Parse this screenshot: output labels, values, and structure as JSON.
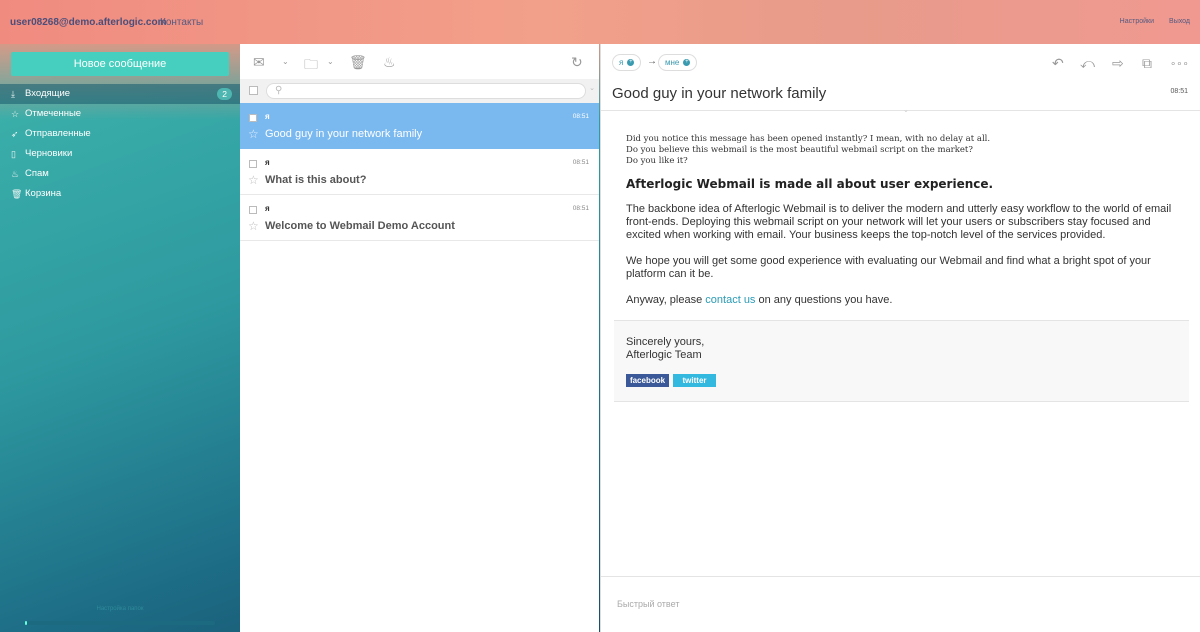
{
  "header": {
    "user_email": "user08268@demo.afterlogic.com",
    "contacts": "Контакты",
    "settings": "Настройки",
    "logout": "Выход"
  },
  "sidebar": {
    "new_message": "Новое сообщение",
    "folders": [
      {
        "label": "Входящие",
        "icon": "inbox-icon",
        "count": "2",
        "active": true
      },
      {
        "label": "Отмеченные",
        "icon": "star-icon"
      },
      {
        "label": "Отправленные",
        "icon": "send-icon"
      },
      {
        "label": "Черновики",
        "icon": "draft-icon"
      },
      {
        "label": "Спам",
        "icon": "spam-icon"
      },
      {
        "label": "Корзина",
        "icon": "trash-icon"
      }
    ],
    "panel_settings": "Настройка папок"
  },
  "message_list": {
    "messages": [
      {
        "from": "я",
        "time": "08:51",
        "subject": "Good guy in your network family",
        "selected": true
      },
      {
        "from": "я",
        "time": "08:51",
        "subject": "What is this about?"
      },
      {
        "from": "я",
        "time": "08:51",
        "subject": "Welcome to Webmail Demo Account"
      }
    ]
  },
  "viewer": {
    "from_chip": "я",
    "to_chip": "мне",
    "subject": "Good guy in your network family",
    "time": "08:51",
    "intro_lines": [
      "Did you notice this message has been opened instantly? I mean, with no delay at all.",
      "Do you believe this webmail is the most beautiful webmail script on the market?",
      "Do you like it?"
    ],
    "heading": "Afterlogic Webmail is made all about user experience.",
    "para1": "The backbone idea of Afterlogic Webmail is to deliver the modern and utterly easy workflow to the world of email front-ends. Deploying this webmail script on your network will let your users or subscribers stay focused and excited when working with email. Your business keeps the top-notch level of the services provided.",
    "para2": "We hope you will get some good experience with evaluating our Webmail and find what a bright spot of your platform can it be.",
    "para3_before": "Anyway, please ",
    "para3_link": "contact us",
    "para3_after": " on any questions you have.",
    "sig_line1": "Sincerely yours,",
    "sig_line2": "Afterlogic Team",
    "facebook": "facebook",
    "twitter": "twitter",
    "quick_reply": "Быстрый ответ"
  },
  "colors": {
    "accent": "#46cfbf",
    "selected_row": "#7ab8f0",
    "link": "#2a9bb5"
  }
}
